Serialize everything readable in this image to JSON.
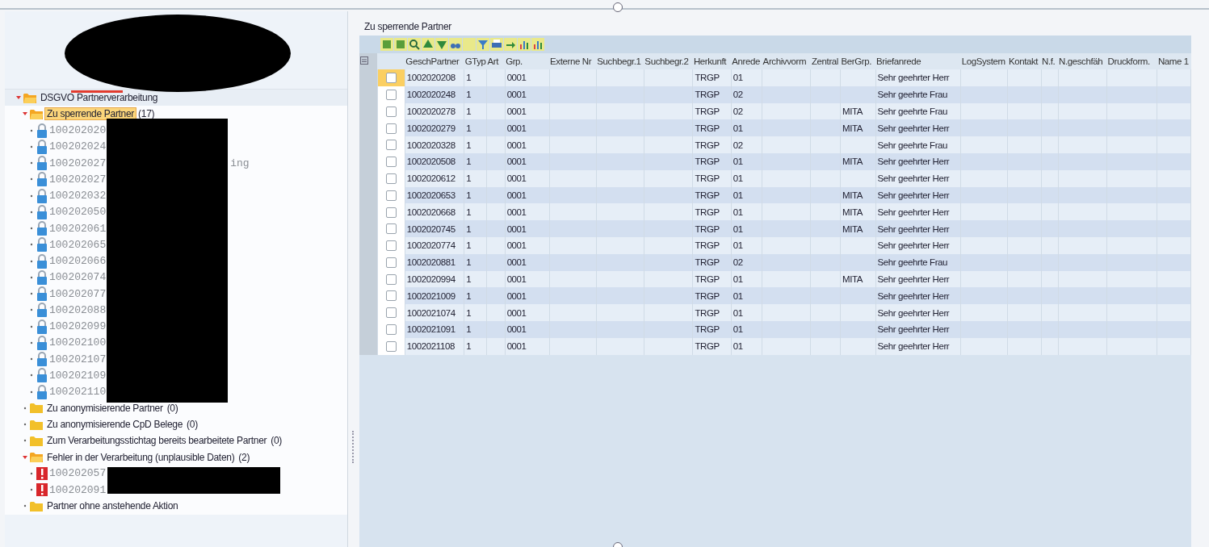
{
  "tree": {
    "items": [
      {
        "kind": "folder",
        "label": "DSGVO Partnerverarbeitung",
        "expanded": true,
        "selected": false,
        "children": [
          {
            "kind": "folder",
            "label": "Zu sperrende Partner",
            "count": "(17)",
            "expanded": true,
            "selected": true,
            "children": [
              {
                "kind": "locked",
                "label": "100202020"
              },
              {
                "kind": "locked",
                "label": "100202024"
              },
              {
                "kind": "locked",
                "label": "100202027",
                "tail": "ing"
              },
              {
                "kind": "locked",
                "label": "100202027"
              },
              {
                "kind": "locked",
                "label": "100202032"
              },
              {
                "kind": "locked",
                "label": "100202050"
              },
              {
                "kind": "locked",
                "label": "100202061"
              },
              {
                "kind": "locked",
                "label": "100202065"
              },
              {
                "kind": "locked",
                "label": "100202066"
              },
              {
                "kind": "locked",
                "label": "100202074"
              },
              {
                "kind": "locked",
                "label": "100202077"
              },
              {
                "kind": "locked",
                "label": "100202088"
              },
              {
                "kind": "locked",
                "label": "100202099"
              },
              {
                "kind": "locked",
                "label": "100202100"
              },
              {
                "kind": "locked",
                "label": "100202107"
              },
              {
                "kind": "locked",
                "label": "100202109"
              },
              {
                "kind": "locked",
                "label": "100202110"
              }
            ]
          },
          {
            "kind": "folder",
            "label": "Zu anonymisierende Partner",
            "count": "(0)",
            "expanded": false,
            "selected": false
          },
          {
            "kind": "folder",
            "label": "Zu anonymisierende CpD Belege",
            "count": "(0)",
            "expanded": false,
            "selected": false
          },
          {
            "kind": "folder",
            "label": "Zum Verarbeitungsstichtag bereits bearbeitete Partner",
            "count": "(0)",
            "expanded": false,
            "selected": false
          },
          {
            "kind": "folder",
            "label": "Fehler in der Verarbeitung (unplausible Daten)",
            "count": "(2)",
            "expanded": true,
            "selected": false,
            "children": [
              {
                "kind": "error",
                "label": "100202057"
              },
              {
                "kind": "error",
                "label": "100202091"
              }
            ]
          },
          {
            "kind": "folder",
            "label": "Partner ohne anstehende Aktion",
            "expanded": false,
            "selected": false
          }
        ]
      }
    ]
  },
  "table": {
    "title": "Zu sperrende Partner",
    "columns": [
      "GeschPartner",
      "GTyp",
      "Art",
      "Grp.",
      "Externe Nr",
      "Suchbegr.1",
      "Suchbegr.2",
      "Herkunft",
      "Anrede",
      "Archivvorm",
      "Zentral",
      "BerGrp.",
      "Briefanrede",
      "LogSystem",
      "Kontakt",
      "N.f.",
      "N.geschfäh",
      "Druckform.",
      "Name 1"
    ],
    "rows": [
      {
        "selected": true,
        "checked": false,
        "cells": [
          "1002020208",
          "1",
          null,
          "0001",
          null,
          null,
          null,
          "TRGP",
          "01",
          null,
          null,
          null,
          "Sehr geehrter Herr"
        ]
      },
      {
        "selected": false,
        "checked": false,
        "cells": [
          "1002020248",
          "1",
          null,
          "0001",
          null,
          null,
          null,
          "TRGP",
          "02",
          null,
          null,
          null,
          "Sehr geehrte Frau"
        ]
      },
      {
        "selected": false,
        "checked": false,
        "cells": [
          "1002020278",
          "1",
          null,
          "0001",
          null,
          null,
          null,
          "TRGP",
          "02",
          null,
          null,
          "MITA",
          "Sehr geehrte Frau"
        ]
      },
      {
        "selected": false,
        "checked": false,
        "cells": [
          "1002020279",
          "1",
          null,
          "0001",
          null,
          null,
          null,
          "TRGP",
          "01",
          null,
          null,
          "MITA",
          "Sehr geehrter Herr"
        ]
      },
      {
        "selected": false,
        "checked": false,
        "cells": [
          "1002020328",
          "1",
          null,
          "0001",
          null,
          null,
          null,
          "TRGP",
          "02",
          null,
          null,
          null,
          "Sehr geehrte Frau"
        ]
      },
      {
        "selected": false,
        "checked": false,
        "cells": [
          "1002020508",
          "1",
          null,
          "0001",
          null,
          null,
          null,
          "TRGP",
          "01",
          null,
          null,
          "MITA",
          "Sehr geehrter Herr"
        ]
      },
      {
        "selected": false,
        "checked": false,
        "cells": [
          "1002020612",
          "1",
          null,
          "0001",
          null,
          null,
          null,
          "TRGP",
          "01",
          null,
          null,
          null,
          "Sehr geehrter Herr"
        ]
      },
      {
        "selected": false,
        "checked": false,
        "cells": [
          "1002020653",
          "1",
          null,
          "0001",
          null,
          null,
          null,
          "TRGP",
          "01",
          null,
          null,
          "MITA",
          "Sehr geehrter Herr"
        ]
      },
      {
        "selected": false,
        "checked": false,
        "cells": [
          "1002020668",
          "1",
          null,
          "0001",
          null,
          null,
          null,
          "TRGP",
          "01",
          null,
          null,
          "MITA",
          "Sehr geehrter Herr"
        ]
      },
      {
        "selected": false,
        "checked": false,
        "cells": [
          "1002020745",
          "1",
          null,
          "0001",
          null,
          null,
          null,
          "TRGP",
          "01",
          null,
          null,
          "MITA",
          "Sehr geehrter Herr"
        ]
      },
      {
        "selected": false,
        "checked": false,
        "cells": [
          "1002020774",
          "1",
          null,
          "0001",
          null,
          null,
          null,
          "TRGP",
          "01",
          null,
          null,
          null,
          "Sehr geehrter Herr"
        ]
      },
      {
        "selected": false,
        "checked": false,
        "cells": [
          "1002020881",
          "1",
          null,
          "0001",
          null,
          null,
          null,
          "TRGP",
          "02",
          null,
          null,
          null,
          "Sehr geehrte Frau"
        ]
      },
      {
        "selected": false,
        "checked": false,
        "cells": [
          "1002020994",
          "1",
          null,
          "0001",
          null,
          null,
          null,
          "TRGP",
          "01",
          null,
          null,
          "MITA",
          "Sehr geehrter Herr"
        ]
      },
      {
        "selected": false,
        "checked": false,
        "cells": [
          "1002021009",
          "1",
          null,
          "0001",
          null,
          null,
          null,
          "TRGP",
          "01",
          null,
          null,
          null,
          "Sehr geehrter Herr"
        ]
      },
      {
        "selected": false,
        "checked": false,
        "cells": [
          "1002021074",
          "1",
          null,
          "0001",
          null,
          null,
          null,
          "TRGP",
          "01",
          null,
          null,
          null,
          "Sehr geehrter Herr"
        ]
      },
      {
        "selected": false,
        "checked": false,
        "cells": [
          "1002021091",
          "1",
          null,
          "0001",
          null,
          null,
          null,
          "TRGP",
          "01",
          null,
          null,
          null,
          "Sehr geehrter Herr"
        ]
      },
      {
        "selected": false,
        "checked": false,
        "cells": [
          "1002021108",
          "1",
          null,
          "0001",
          null,
          null,
          null,
          "TRGP",
          "01",
          null,
          null,
          null,
          "Sehr geehrter Herr"
        ]
      }
    ]
  }
}
